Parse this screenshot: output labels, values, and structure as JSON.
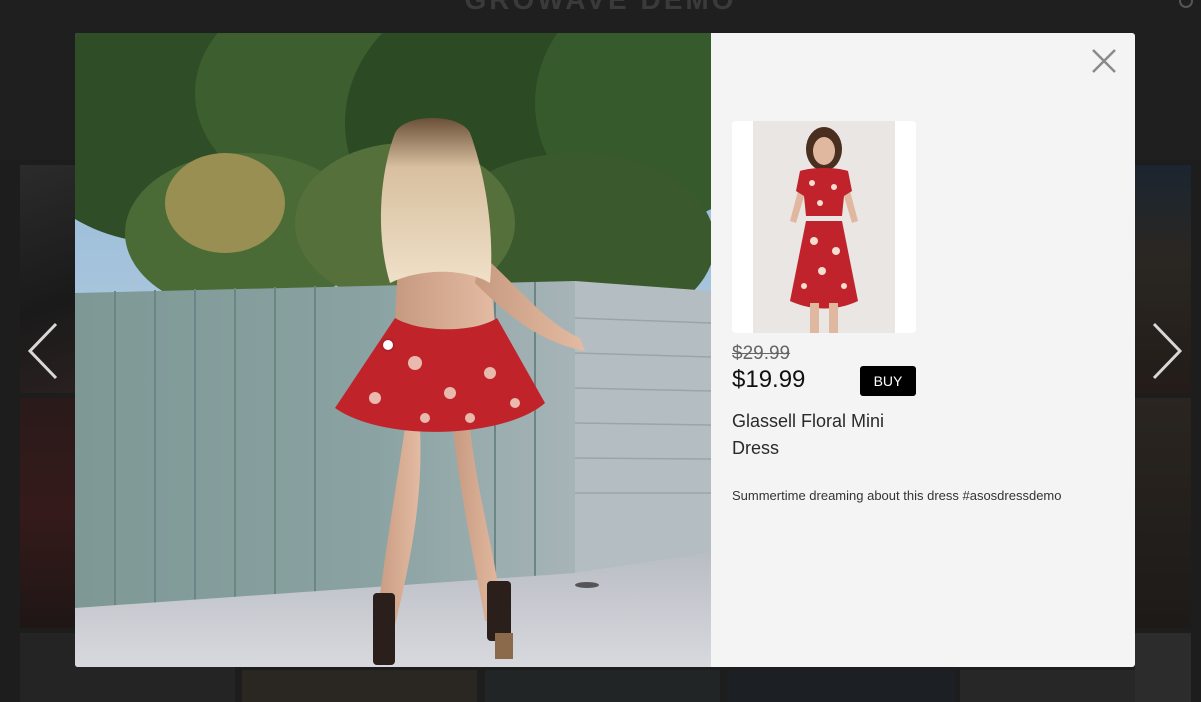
{
  "background": {
    "site_title": "GROWAVE DEMO"
  },
  "icons": {
    "prev": "chevron-left-icon",
    "next": "chevron-right-icon",
    "close": "close-icon",
    "search": "search-icon"
  },
  "colors": {
    "buy_button": "#000000",
    "modal_bg": "#f4f4f4",
    "overlay": "#1d1d1d"
  },
  "product": {
    "old_price": "$29.99",
    "price": "$19.99",
    "buy_label": "BUY",
    "title": "Glassell Floral Mini Dress"
  },
  "post": {
    "caption": "Summertime dreaming about this dress #asosdressdemo"
  }
}
